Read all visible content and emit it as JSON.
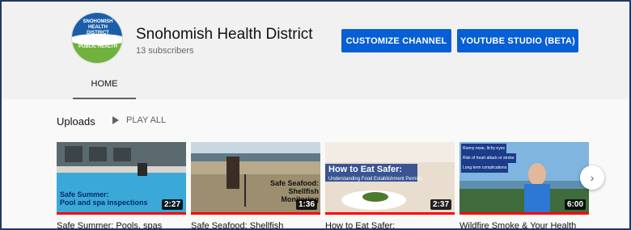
{
  "channel": {
    "name": "Snohomish Health District",
    "subscribers": "13 subscribers",
    "logo_top_text": "SNOHOMISH HEALTH DISTRICT",
    "logo_bottom_text": "PUBLIC HEALTH"
  },
  "buttons": {
    "customize": "CUSTOMIZE CHANNEL",
    "studio": "YOUTUBE STUDIO (BETA)"
  },
  "tabs": {
    "home": "HOME"
  },
  "uploads": {
    "title": "Uploads",
    "play_all": "PLAY ALL",
    "videos": [
      {
        "title": "Safe Summer: Pools, spas",
        "duration": "2:27",
        "overlay": "Safe Summer:\nPool and spa inspections"
      },
      {
        "title": "Safe Seafood: Shellfish",
        "duration": "1:36",
        "overlay": "Safe Seafood:\nShellfish\nMonitoring"
      },
      {
        "title": "How to Eat Safer:",
        "duration": "2:37",
        "overlay_title": "How to Eat Safer:",
        "overlay_sub": "Understanding Food Establishment Permits"
      },
      {
        "title": "Wildfire Smoke & Your Health",
        "duration": "6:00",
        "overlay_lines": [
          "Runny nose, Itchy eyes",
          "Risk of heart attack or stroke",
          "Long term complications"
        ]
      }
    ]
  },
  "colors": {
    "accent_blue": "#065fd4",
    "progress_red": "#ff0000"
  }
}
